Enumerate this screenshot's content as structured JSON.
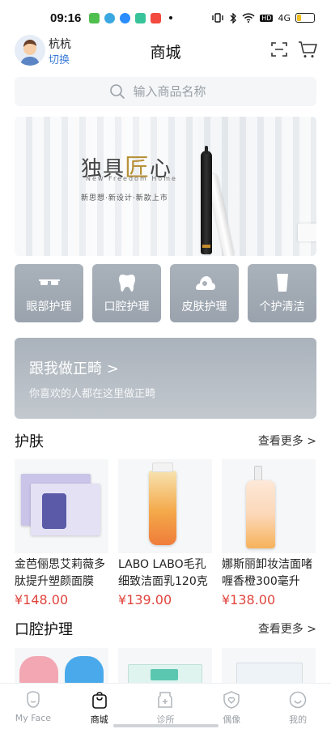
{
  "status_bar": {
    "time": "09:16",
    "network": "4G",
    "battery_level": 0.3
  },
  "header": {
    "user_name": "杭杭",
    "switch_label": "切换",
    "title": "商城"
  },
  "search": {
    "placeholder": "输入商品名称"
  },
  "banner": {
    "title_part1": "独具",
    "title_accent": "匠",
    "title_part2": "心",
    "subtitle": "New Freedom Home",
    "tagline": "新思想·新设计·新款上市"
  },
  "categories": [
    {
      "label": "眼部护理",
      "icon": "glasses-icon"
    },
    {
      "label": "口腔护理",
      "icon": "tooth-icon"
    },
    {
      "label": "皮肤护理",
      "icon": "skin-icon"
    },
    {
      "label": "个护清洁",
      "icon": "cup-icon"
    }
  ],
  "follow_card": {
    "title": "跟我做正畸 >",
    "subtitle": "你喜欢的人都在这里做正畸"
  },
  "sections": [
    {
      "title": "护肤",
      "more_label": "查看更多 >",
      "products": [
        {
          "name": "金芭俪思艾莉薇多肽提升塑颜面膜",
          "price": "¥148.00"
        },
        {
          "name": "LABO LABO毛孔细致洁面乳120克",
          "price": "¥139.00"
        },
        {
          "name": "娜斯丽卸妆洁面啫喱香橙300毫升",
          "price": "¥138.00"
        }
      ]
    },
    {
      "title": "口腔护理",
      "more_label": "查看更多 >"
    }
  ],
  "tabbar": [
    {
      "label": "My Face",
      "icon": "face-icon",
      "active": false
    },
    {
      "label": "商城",
      "icon": "shop-bag-icon",
      "active": true
    },
    {
      "label": "诊所",
      "icon": "clinic-icon",
      "active": false
    },
    {
      "label": "偶像",
      "icon": "heart-badge-icon",
      "active": false
    },
    {
      "label": "我的",
      "icon": "smile-icon",
      "active": false
    }
  ],
  "colors": {
    "accent_blue": "#3b7dd8",
    "price_red": "#e0453d",
    "category_bg": "#a9b1ba",
    "gold": "#b8923a"
  }
}
